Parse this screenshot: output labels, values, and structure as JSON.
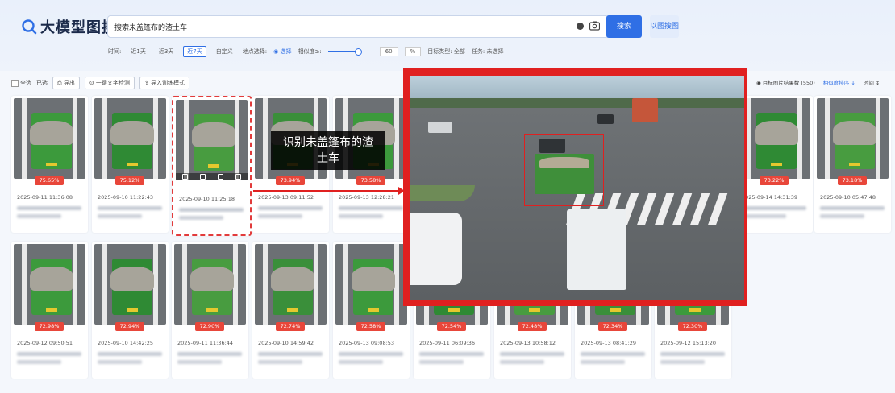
{
  "header": {
    "logo_text": "大模型图搜",
    "search_query": "搜索未盖篷布的渣土车",
    "search_button": "搜索",
    "image_search_button": "以图搜图",
    "filters": {
      "time_label": "时间:",
      "time_options": [
        "近1天",
        "近3天",
        "近7天",
        "自定义"
      ],
      "active_time": "近7天",
      "location_label": "地点选择:",
      "location_value": "选择",
      "similarity_label": "相似度≥:",
      "similarity_value": "60",
      "similarity_unit": "%",
      "target_label": "目标类型: 全部",
      "task_label": "任务: 未选择"
    }
  },
  "toolbar": {
    "select_all": "全选",
    "selected": "已选",
    "export": "导出",
    "one_click": "一键文字检测",
    "import_training": "导入训练模式",
    "right_info": "目标图片结果数 (550)",
    "sort_similarity": "相似度排序",
    "sort_time": "时间"
  },
  "cards_row1": [
    {
      "score": "75.65%",
      "time": "2025-09-11 11:36:08"
    },
    {
      "score": "75.12%",
      "time": "2025-09-10 11:22:43"
    },
    {
      "score": "",
      "time": "2025-09-10 11:25:18"
    },
    {
      "score": "73.94%",
      "time": "2025-09-13 09:11:52"
    },
    {
      "score": "73.58%",
      "time": "2025-09-13 12:28:21"
    },
    {
      "score": "73.22%",
      "time": "2025-09-14 14:31:39"
    },
    {
      "score": "73.18%",
      "time": "2025-09-10 05:47:48"
    }
  ],
  "cards_row2": [
    {
      "score": "72.98%",
      "time": "2025-09-12 09:50:51"
    },
    {
      "score": "72.94%",
      "time": "2025-09-10 14:42:25"
    },
    {
      "score": "72.90%",
      "time": "2025-09-11 11:36:44"
    },
    {
      "score": "72.74%",
      "time": "2025-09-10 14:59:42"
    },
    {
      "score": "72.58%",
      "time": "2025-09-13 09:08:53"
    },
    {
      "score": "72.54%",
      "time": "2025-09-11 06:09:36"
    },
    {
      "score": "72.48%",
      "time": "2025-09-13 10:58:12"
    },
    {
      "score": "72.34%",
      "time": "2025-09-13 08:41:29"
    },
    {
      "score": "72.30%",
      "time": "2025-09-12 15:13:20"
    }
  ],
  "overlay": {
    "tooltip_line1": "识别未盖篷布的渣",
    "tooltip_line2": "土车"
  },
  "colors": {
    "accent": "#2f6fe5",
    "alert": "#e02020",
    "badge": "#e8463a"
  }
}
